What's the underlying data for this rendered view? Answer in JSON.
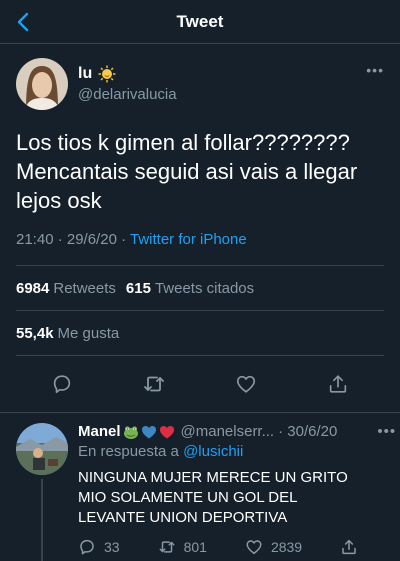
{
  "header": {
    "title": "Tweet"
  },
  "tweet": {
    "name": "lu",
    "handle": "@delarivalucia",
    "text": "Los tios k gimen al follar???????? Mencantais seguid asi vais a llegar lejos osk",
    "timestamp": "21:40 · 29/6/20 · ",
    "source": "Twitter for iPhone",
    "retweets_count": "6984",
    "retweets_label": "Retweets",
    "quotes_count": "615",
    "quotes_label": "Tweets citados",
    "likes_count": "55,4k",
    "likes_label": "Me gusta"
  },
  "reply": {
    "name": "Manel",
    "handle": "@manelserr...",
    "date": "· 30/6/20",
    "replying_prefix": "En respuesta a",
    "replying_to": "@lusichii",
    "text": "NINGUNA MUJER MERECE UN GRITO MIO SOLAMENTE UN GOL DEL LEVANTE UNION DEPORTIVA",
    "comments": "33",
    "retweets": "801",
    "likes": "2839"
  },
  "icons": {
    "back": "chevron-left-icon",
    "author_badge": "sun-emoji-icon",
    "more": "more-dots-icon",
    "reply": "reply-icon",
    "retweet": "retweet-icon",
    "like": "heart-icon",
    "share": "share-icon",
    "reply_emojis": [
      "frog-emoji-icon",
      "blue-heart-emoji-icon",
      "red-heart-emoji-icon"
    ]
  },
  "colors": {
    "background": "#15202b",
    "accent": "#1da1f2",
    "secondary_text": "#8899a6",
    "divider": "#38444d"
  }
}
